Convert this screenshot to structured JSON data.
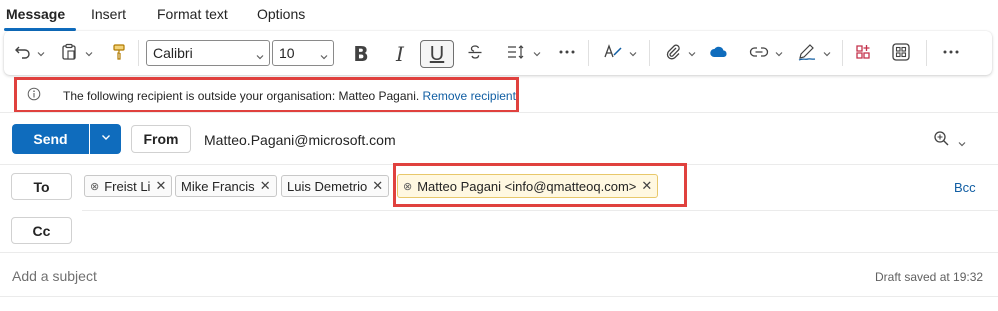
{
  "tabs": [
    "Message",
    "Insert",
    "Format text",
    "Options"
  ],
  "ribbon": {
    "font_name": "Calibri",
    "font_size": "10",
    "bold": "B",
    "italic": "I",
    "underline": "U"
  },
  "infobar": {
    "message": "The following recipient is outside your organisation: Matteo Pagani.",
    "action": "Remove recipient"
  },
  "send": {
    "label": "Send",
    "from_label": "From",
    "from_address": "Matteo.Pagani@microsoft.com"
  },
  "to": {
    "label": "To",
    "recipients": [
      "Freist Li",
      "Mike Francis",
      "Luis Demetrio",
      "Matteo Pagani <info@qmatteoq.com>"
    ],
    "bcc_label": "Bcc"
  },
  "cc": {
    "label": "Cc"
  },
  "subject": {
    "placeholder": "Add a subject",
    "draft_status": "Draft saved at 19:32"
  },
  "colors": {
    "accent": "#0f6cbd",
    "highlight_border": "#e0413e",
    "warning_chip_bg": "#fff8e1"
  }
}
